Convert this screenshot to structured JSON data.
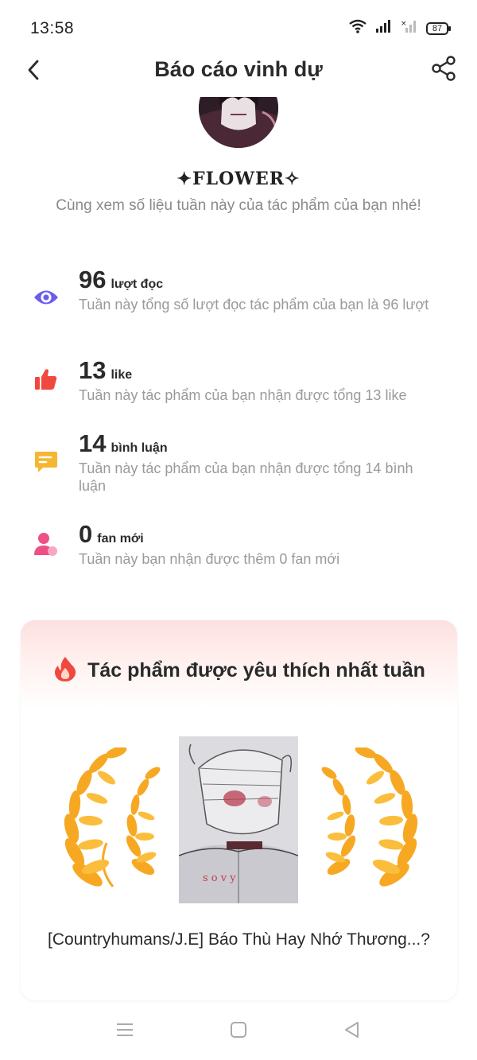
{
  "status_bar": {
    "time": "13:58",
    "battery": "87"
  },
  "header": {
    "title": "Báo cáo vinh dự",
    "back_icon": "chevron-left-icon",
    "share_icon": "share-icon"
  },
  "profile": {
    "username": "✦FLOWER✧",
    "subtitle": "Cùng xem số liệu tuần này của tác phẩm của bạn nhé!"
  },
  "stats": [
    {
      "icon": "eye-icon",
      "color": "#6b5cf0",
      "number": "96",
      "unit": "lượt đọc",
      "description": "Tuần này tổng số lượt đọc tác phẩm của bạn là 96 lượt"
    },
    {
      "icon": "thumbs-up-icon",
      "color": "#f0483e",
      "number": "13",
      "unit": "like",
      "description": "Tuần này tác phẩm của bạn nhận được tổng 13 like"
    },
    {
      "icon": "comment-icon",
      "color": "#f5b632",
      "number": "14",
      "unit": "bình luận",
      "description": "Tuần này tác phẩm của bạn nhận được tổng 14 bình luận"
    },
    {
      "icon": "person-icon",
      "color": "#ee4f86",
      "number": "0",
      "unit": "fan mới",
      "description": "Tuần này bạn nhận được thêm 0 fan mới"
    }
  ],
  "favorite": {
    "title": "Tác phẩm được yêu thích nhất tuần",
    "icon": "fire-icon",
    "work_title": "[Countryhumans/J.E] Báo Thù Hay Nhớ Thương...?"
  },
  "colors": {
    "accent_purple": "#6b5cf0",
    "accent_red": "#f0483e",
    "accent_yellow": "#f5b632",
    "accent_pink": "#ee4f86",
    "laurel_gold": "#f7a823"
  }
}
